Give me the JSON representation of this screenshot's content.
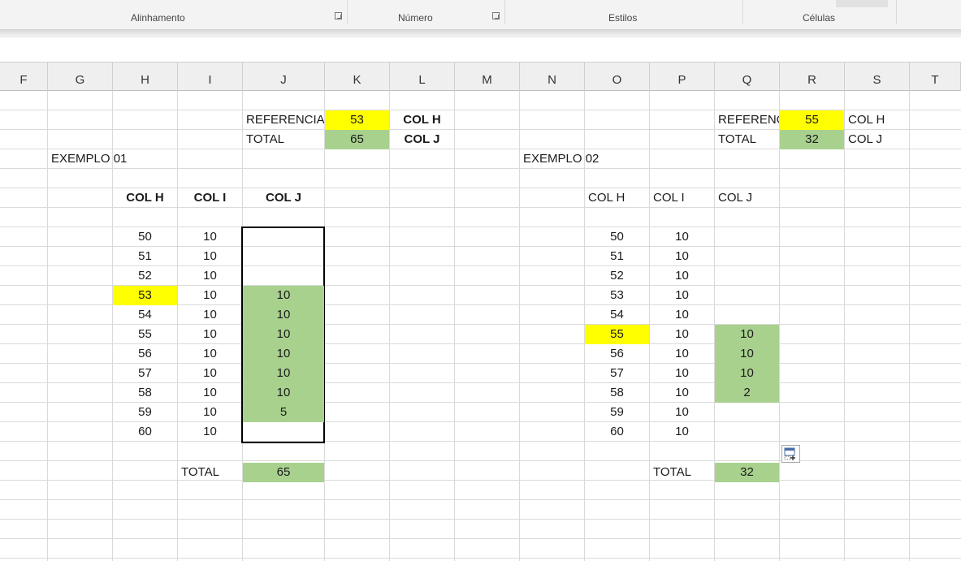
{
  "ribbon": {
    "groups": [
      "Alinhamento",
      "Número",
      "Estilos",
      "Células"
    ]
  },
  "columns": [
    "F",
    "G",
    "H",
    "I",
    "J",
    "K",
    "L",
    "M",
    "N",
    "O",
    "P",
    "Q",
    "R",
    "S",
    "T"
  ],
  "colors": {
    "highlight": "#ffff00",
    "result": "#a9d18e"
  },
  "example1": {
    "ref_label": "REFERENCIA",
    "ref_value": "53",
    "ref_col": "COL H",
    "total_label": "TOTAL",
    "total_value": "65",
    "total_col": "COL J",
    "title": "EXEMPLO 01",
    "headers": [
      "COL H",
      "COL I",
      "COL J"
    ],
    "rows": [
      {
        "h": "50",
        "i": "10",
        "j": ""
      },
      {
        "h": "51",
        "i": "10",
        "j": ""
      },
      {
        "h": "52",
        "i": "10",
        "j": ""
      },
      {
        "h": "53",
        "i": "10",
        "j": "10"
      },
      {
        "h": "54",
        "i": "10",
        "j": "10"
      },
      {
        "h": "55",
        "i": "10",
        "j": "10"
      },
      {
        "h": "56",
        "i": "10",
        "j": "10"
      },
      {
        "h": "57",
        "i": "10",
        "j": "10"
      },
      {
        "h": "58",
        "i": "10",
        "j": "10"
      },
      {
        "h": "59",
        "i": "10",
        "j": "5"
      },
      {
        "h": "60",
        "i": "10",
        "j": ""
      }
    ],
    "footer_label": "TOTAL",
    "footer_value": "65"
  },
  "example2": {
    "ref_label": "REFERENCIA",
    "ref_value": "55",
    "ref_col": "COL H",
    "total_label": "TOTAL",
    "total_value": "32",
    "total_col": "COL J",
    "title": "EXEMPLO 02",
    "headers": [
      "COL H",
      "COL I",
      "COL J"
    ],
    "rows": [
      {
        "h": "50",
        "i": "10",
        "j": ""
      },
      {
        "h": "51",
        "i": "10",
        "j": ""
      },
      {
        "h": "52",
        "i": "10",
        "j": ""
      },
      {
        "h": "53",
        "i": "10",
        "j": ""
      },
      {
        "h": "54",
        "i": "10",
        "j": ""
      },
      {
        "h": "55",
        "i": "10",
        "j": "10"
      },
      {
        "h": "56",
        "i": "10",
        "j": "10"
      },
      {
        "h": "57",
        "i": "10",
        "j": "10"
      },
      {
        "h": "58",
        "i": "10",
        "j": "2"
      },
      {
        "h": "59",
        "i": "10",
        "j": ""
      },
      {
        "h": "60",
        "i": "10",
        "j": ""
      }
    ],
    "footer_label": "TOTAL",
    "footer_value": "32"
  }
}
